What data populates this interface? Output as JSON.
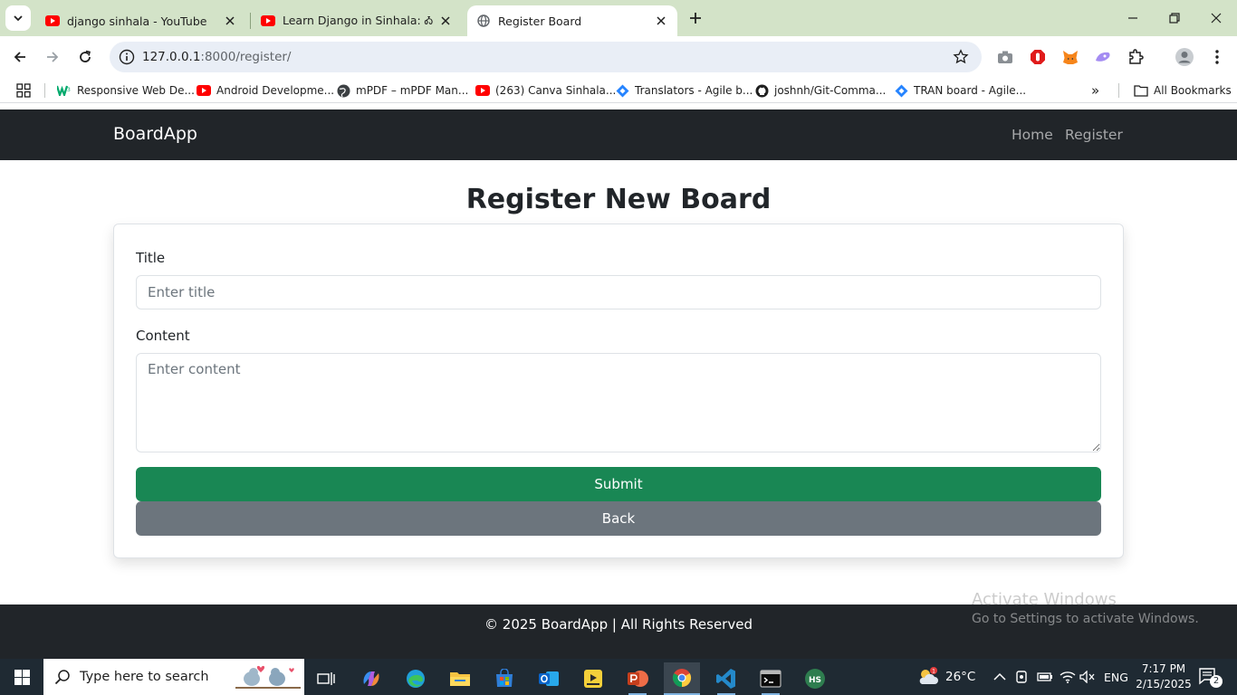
{
  "browser": {
    "tabs": [
      {
        "title": "django sinhala - YouTube",
        "active": false
      },
      {
        "title": "Learn Django in Sinhala: ᎣᎣ ᎣᎣ",
        "active": false
      },
      {
        "title": "Register Board",
        "active": true
      }
    ],
    "url_host": "127.0.0.1",
    "url_path": ":8000/register/",
    "bookmarks": [
      "Responsive Web De...",
      "Android Developme...",
      "mPDF – mPDF Man...",
      "(263) Canva Sinhala...",
      "Translators - Agile b...",
      "joshnh/Git-Comma...",
      "TRAN board - Agile..."
    ],
    "all_bookmarks": "All Bookmarks",
    "more_bookmarks": "»"
  },
  "app": {
    "brand": "BoardApp",
    "nav": {
      "home": "Home",
      "register": "Register"
    },
    "page_title": "Register New Board",
    "form": {
      "title_label": "Title",
      "title_placeholder": "Enter title",
      "content_label": "Content",
      "content_placeholder": "Enter content",
      "submit": "Submit",
      "back": "Back"
    },
    "footer": "© 2025 BoardApp | All Rights Reserved"
  },
  "watermark": {
    "line1": "Activate Windows",
    "line2": "Go to Settings to activate Windows."
  },
  "taskbar": {
    "search_placeholder": "Type here to search",
    "weather": "26°C",
    "lang": "ENG",
    "time": "7:17 PM",
    "date": "2/15/2025",
    "notifications": "2"
  },
  "colors": {
    "navbar": "#212529",
    "submit": "#198754",
    "back": "#6c757d",
    "tabstrip": "#d3e3c8"
  }
}
